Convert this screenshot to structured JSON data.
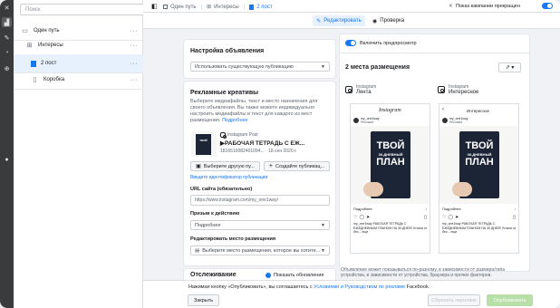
{
  "sidebar": {
    "search_placeholder": "Поиск",
    "items": [
      {
        "label": "Один путь",
        "more": "···"
      },
      {
        "label": "Интересы",
        "more": "···"
      },
      {
        "label": "2 пост",
        "more": "···"
      },
      {
        "label": "Коробка",
        "more": "···"
      }
    ]
  },
  "topbar": {
    "crumbs": [
      "Один путь",
      "Интересы",
      "2 пост"
    ],
    "toggle_label": "Показ кампании прекращен"
  },
  "tabs": {
    "edit": "Редактировать",
    "preview": "Проверка"
  },
  "ad_settings": {
    "title": "Настройка объявления",
    "select_value": "Использовать существующую публикацию"
  },
  "creatives": {
    "title": "Рекламные креативы",
    "description": "Выберите медиафайлы, текст и место назначения для своего объявления. Вы также можете индивидуально настроить медиафайлы и текст для каждого из мест размещения.",
    "more_link": "Подробнее",
    "post_source": "Instagram Post",
    "post_title": "▶РАБОЧАЯ ТЕТРАДЬ С ЕЖ...",
    "post_meta": "1816510082401094... · 18 сен 2020 г.",
    "choose_other_btn": "Выберите другую пу...",
    "create_btn": "Создайте публикац...",
    "enter_id_link": "Введите идентификатор публикации",
    "url_label": "URL сайта (обязательно)",
    "url_value": "https://www.instagram.com/my_one1way/",
    "cta_label": "Призыв к действию",
    "cta_value": "Подробнее",
    "placement_label": "Редактировать место размещения",
    "placement_value": "Выберите место размещения, которое вы хотите..."
  },
  "tracking": {
    "title": "Отслеживание",
    "checkbox_label": "Показать обновления"
  },
  "preview": {
    "toggle_label": "Включить предпросмотр",
    "placements_title": "2 места размещения",
    "placements": [
      {
        "platform": "Instagram",
        "name": "Лента"
      },
      {
        "platform": "Instagram",
        "name": "Интересное"
      }
    ],
    "ig_logo_text": "Instagram",
    "explore_label": "Интересное",
    "account_name": "my_one1way",
    "account_sub": "Реклама",
    "book_line1": "ТВОЙ",
    "book_line2": "30-ДНЕВНЫЙ",
    "book_line3": "ПЛАН",
    "more_label": "Подробнее",
    "caption": "my_one1way РАБОЧАЯ ТЕТРАДЬ С ЕЖЕДНЕВНЫМ ПЛАНОМ НА 30 ДНЕЙ! Устали от бес... еще",
    "bottom_note": "Объявление может показываться по-разному, в зависимости от размера/типа устройства, в зависимости от устройства, браузера и прочих факторов."
  },
  "footer": {
    "agreement_prefix": "Нажимая кнопку «Опубликовать», вы соглашаетесь с",
    "agreement_link": "Условиями и Руководством по рекламе",
    "agreement_suffix": "Facebook.",
    "close_btn": "Закрыть",
    "reset_btn": "Сбросить черновик",
    "publish_btn": "Опубликовать"
  },
  "colors": {
    "accent": "#1877f2",
    "rail": "#3a3b3c",
    "publish_disabled": "#b8dfa8"
  }
}
